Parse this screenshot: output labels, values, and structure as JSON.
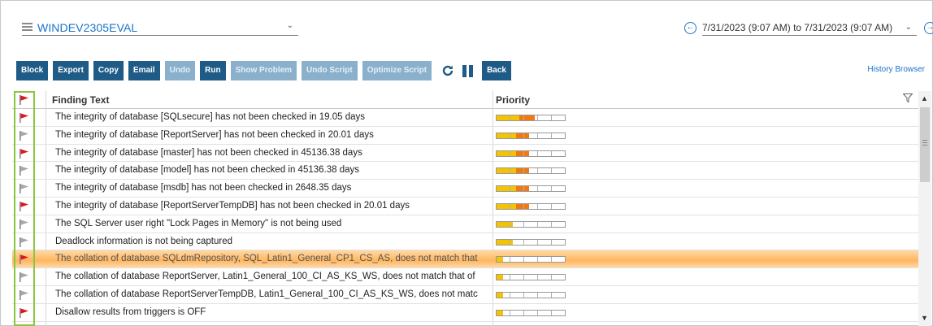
{
  "header": {
    "server_name": "WINDEV2305EVAL",
    "date_range": "7/31/2023 (9:07 AM) to 7/31/2023 (9:07 AM)"
  },
  "toolbar": {
    "buttons": [
      {
        "label": "Block",
        "enabled": true
      },
      {
        "label": "Export",
        "enabled": true
      },
      {
        "label": "Copy",
        "enabled": true
      },
      {
        "label": "Email",
        "enabled": true
      },
      {
        "label": "Undo",
        "enabled": false
      },
      {
        "label": "Run",
        "enabled": true
      },
      {
        "label": "Show Problem",
        "enabled": false
      },
      {
        "label": "Undo Script",
        "enabled": false
      },
      {
        "label": "Optimize Script",
        "enabled": false
      }
    ],
    "back_label": "Back",
    "history_link": "History Browser"
  },
  "grid": {
    "columns": {
      "finding": "Finding Text",
      "priority": "Priority"
    },
    "rows": [
      {
        "flag": "red",
        "text": "The integrity of database [SQLsecure] has not been checked in 19.05 days",
        "priority": 0.56,
        "selected": false
      },
      {
        "flag": "gray",
        "text": "The integrity of database [ReportServer] has not been checked in 20.01 days",
        "priority": 0.48,
        "selected": false
      },
      {
        "flag": "red",
        "text": "The integrity of database [master] has not been checked in 45136.38 days",
        "priority": 0.48,
        "selected": false
      },
      {
        "flag": "gray",
        "text": "The integrity of database [model] has not been checked in 45136.38 days",
        "priority": 0.48,
        "selected": false
      },
      {
        "flag": "gray",
        "text": "The integrity of database [msdb] has not been checked in 2648.35 days",
        "priority": 0.48,
        "selected": false
      },
      {
        "flag": "red",
        "text": "The integrity of database [ReportServerTempDB] has not been checked in 20.01 days",
        "priority": 0.48,
        "selected": false
      },
      {
        "flag": "gray",
        "text": "The SQL Server user right \"Lock Pages in Memory\" is not being used",
        "priority": 0.24,
        "selected": false
      },
      {
        "flag": "gray",
        "text": "Deadlock information is not being captured",
        "priority": 0.24,
        "selected": false
      },
      {
        "flag": "red",
        "text": "The collation of database SQLdmRepository, SQL_Latin1_General_CP1_CS_AS, does not match that",
        "priority": 0.1,
        "selected": true
      },
      {
        "flag": "gray",
        "text": "The collation of database ReportServer, Latin1_General_100_CI_AS_KS_WS, does not match that of",
        "priority": 0.1,
        "selected": false
      },
      {
        "flag": "gray",
        "text": "The collation of database ReportServerTempDB, Latin1_General_100_CI_AS_KS_WS, does not matc",
        "priority": 0.1,
        "selected": false
      },
      {
        "flag": "red",
        "text": "Disallow results from triggers is OFF",
        "priority": 0.1,
        "selected": false
      }
    ]
  },
  "colors": {
    "flag_red": "#e0141e",
    "flag_gray": "#a8a8a8",
    "button_blue": "#1e5b86",
    "link_blue": "#1a73c8",
    "priority_yellow": "#f5c400",
    "priority_orange": "#f07a10",
    "highlight_border": "#8cc63f"
  },
  "icons": [
    "server-icon",
    "chevron-down-icon",
    "arrow-left-circle-icon",
    "arrow-right-circle-icon",
    "refresh-icon",
    "pause-icon",
    "flag-icon",
    "filter-icon",
    "scroll-up-icon",
    "scroll-down-icon"
  ]
}
